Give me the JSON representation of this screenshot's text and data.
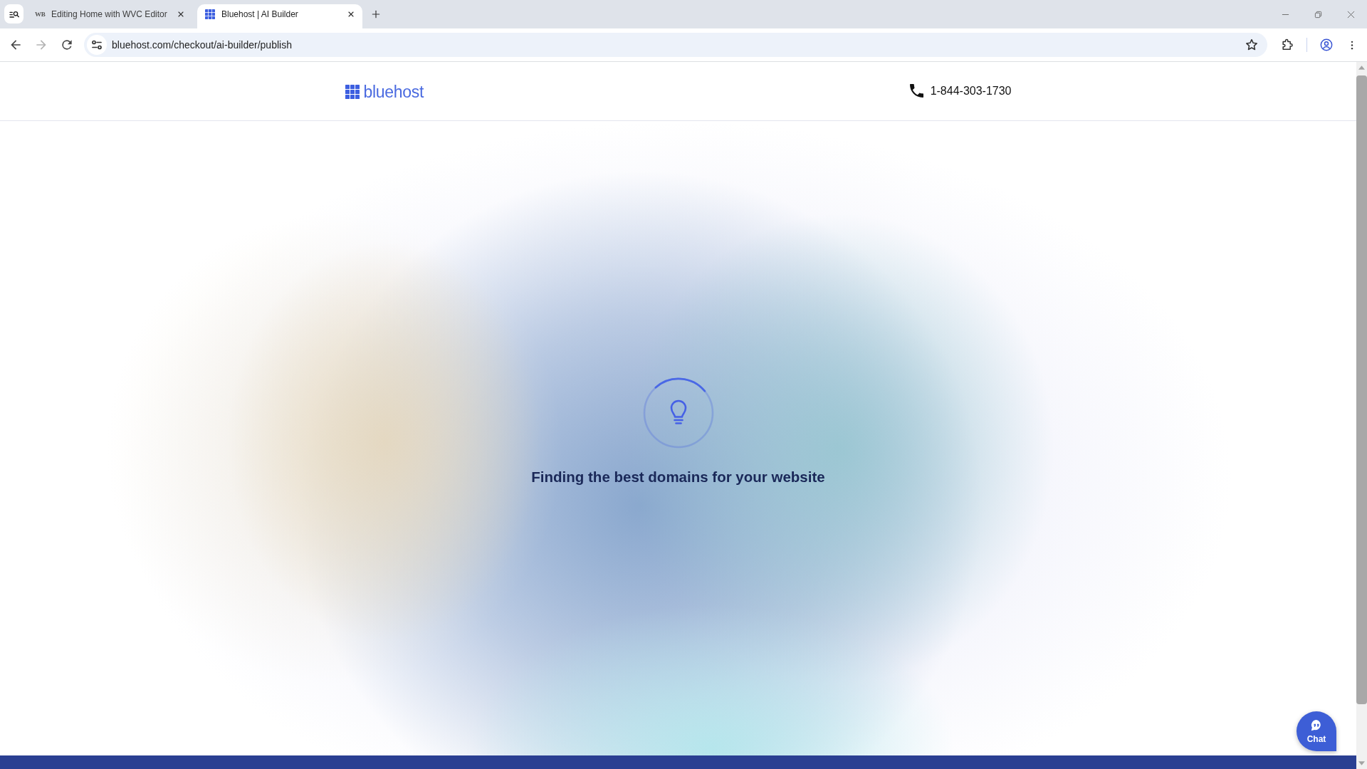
{
  "browser": {
    "tabs": [
      {
        "label": "Editing Home with WVC Editor",
        "favicon": "WB",
        "selected": false
      },
      {
        "label": "Bluehost | AI Builder",
        "selected": true
      }
    ],
    "address": "bluehost.com/checkout/ai-builder/publish",
    "forward_disabled": true
  },
  "header": {
    "logo": "bluehost",
    "phone": "1-844-303-1730"
  },
  "loader": {
    "message": "Finding the best domains for your website"
  },
  "chat": {
    "label": "Chat"
  }
}
